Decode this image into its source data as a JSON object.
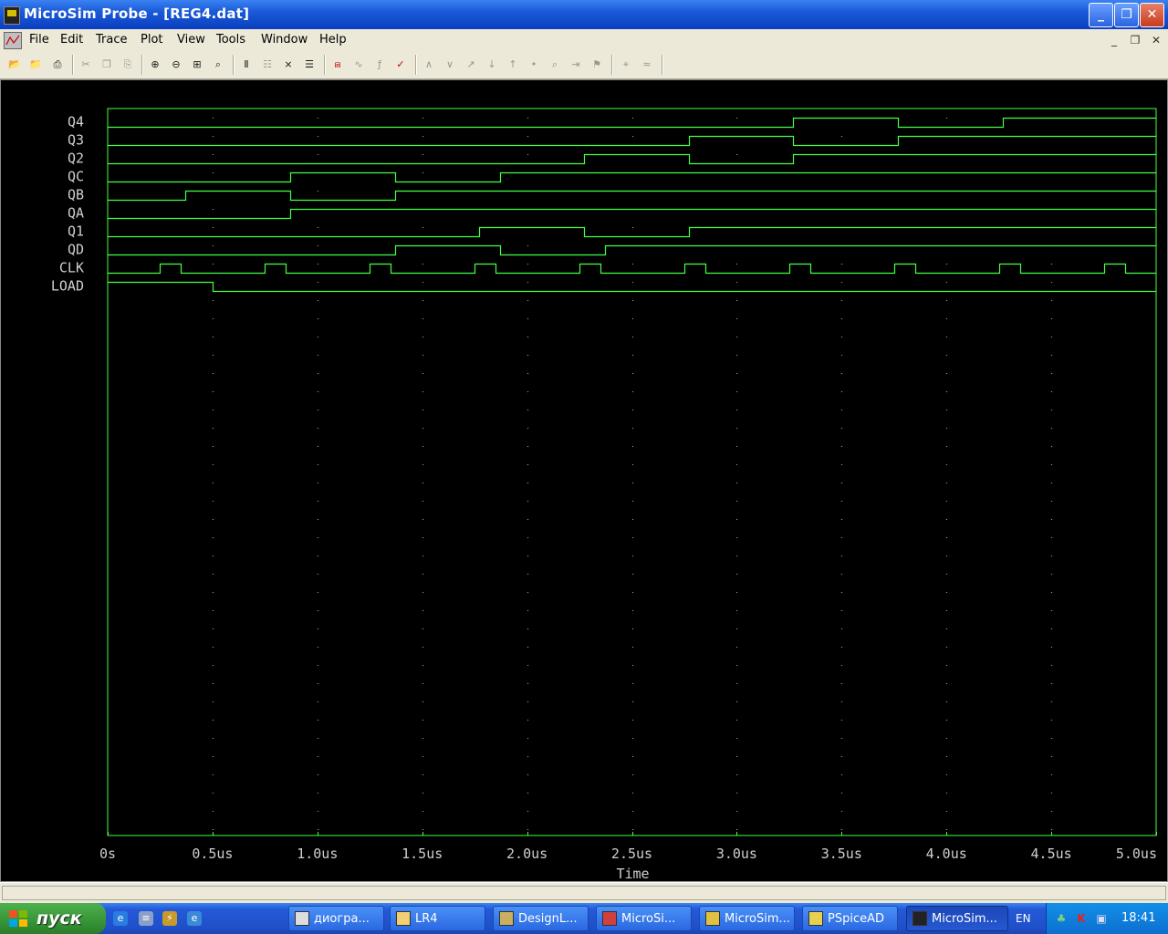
{
  "window": {
    "title": "MicroSim Probe - [REG4.dat]",
    "controls": {
      "minimize": "_",
      "maximize": "❐",
      "close": "✕"
    }
  },
  "menu": {
    "items": [
      "File",
      "Edit",
      "Trace",
      "Plot",
      "View",
      "Tools",
      "Window",
      "Help"
    ],
    "mdi": {
      "minimize": "_",
      "restore": "❐",
      "close": "✕"
    }
  },
  "toolbar": {
    "icons": [
      "open-folder-icon",
      "open-file-icon",
      "print-icon",
      "cut-icon",
      "copy-icon",
      "paste-icon",
      "zoom-in-icon",
      "zoom-out-icon",
      "zoom-area-icon",
      "zoom-fit-icon",
      "axis-settings-icon",
      "add-plot-icon",
      "toggle-digital-icon",
      "list-icon",
      "add-trace-icon",
      "eval-goal-icon",
      "fourier-icon",
      "cursor-toggle-icon",
      "peak-icon",
      "trough-icon",
      "slope-icon",
      "min-icon",
      "max-icon",
      "point-icon",
      "search-icon",
      "next-transition-icon",
      "mark-label-icon",
      "mark-data-icon"
    ]
  },
  "colors": {
    "trace": "#44ff44",
    "grid_dots": "#9a9a9a",
    "axis_text": "#cfcfcf",
    "background": "#000000"
  },
  "chart_data": {
    "type": "line",
    "kind": "digital-timing",
    "xlabel": "Time",
    "xlim": [
      0,
      5.0
    ],
    "x_unit": "us",
    "x_tick_values": [
      0,
      0.5,
      1.0,
      1.5,
      2.0,
      2.5,
      3.0,
      3.5,
      4.0,
      4.5,
      5.0
    ],
    "x_ticks": [
      "0s",
      "0.5us",
      "1.0us",
      "1.5us",
      "2.0us",
      "2.5us",
      "3.0us",
      "3.5us",
      "4.0us",
      "4.5us",
      "5.0us"
    ],
    "grid": true,
    "series": [
      {
        "name": "Q4",
        "initial": 0,
        "transitions": [
          3.27,
          3.77,
          4.27
        ]
      },
      {
        "name": "Q3",
        "initial": 0,
        "transitions": [
          2.77,
          3.27,
          3.77
        ]
      },
      {
        "name": "Q2",
        "initial": 0,
        "transitions": [
          2.27,
          2.77,
          3.27
        ]
      },
      {
        "name": "QC",
        "initial": 0,
        "transitions": [
          0.87,
          1.37,
          1.87
        ]
      },
      {
        "name": "QB",
        "initial": 0,
        "transitions": [
          0.37,
          0.87,
          1.37
        ]
      },
      {
        "name": "QA",
        "initial": 0,
        "transitions": [
          0.87
        ]
      },
      {
        "name": "Q1",
        "initial": 0,
        "transitions": [
          1.77,
          2.27,
          2.77
        ]
      },
      {
        "name": "QD",
        "initial": 0,
        "transitions": [
          1.37,
          1.87,
          2.37
        ]
      },
      {
        "name": "CLK",
        "initial": 0,
        "transitions": [
          0.25,
          0.35,
          0.75,
          0.85,
          1.25,
          1.35,
          1.75,
          1.85,
          2.25,
          2.35,
          2.75,
          2.85,
          3.25,
          3.35,
          3.75,
          3.85,
          4.25,
          4.35,
          4.75,
          4.85
        ]
      },
      {
        "name": "LOAD",
        "initial": 1,
        "transitions": [
          0.5
        ]
      }
    ]
  },
  "taskbar": {
    "start_label": "пуск",
    "quicklaunch": [
      "ie-icon",
      "notepad-icon",
      "winamp-icon",
      "browser-icon"
    ],
    "tasks": [
      {
        "label": "диогра...",
        "icon": "document-icon",
        "active": false
      },
      {
        "label": "LR4",
        "icon": "folder-icon",
        "active": false
      },
      {
        "label": "DesignL...",
        "icon": "designlab-icon",
        "active": false
      },
      {
        "label": "MicroSi...",
        "icon": "microsim-icon",
        "active": false
      },
      {
        "label": "MicroSim...",
        "icon": "microsim-schematics-icon",
        "active": false
      },
      {
        "label": "PSpiceAD",
        "icon": "pspice-icon",
        "active": false
      },
      {
        "label": "MicroSim...",
        "icon": "probe-icon",
        "active": true
      }
    ],
    "lang": "EN",
    "clock": "18:41"
  }
}
